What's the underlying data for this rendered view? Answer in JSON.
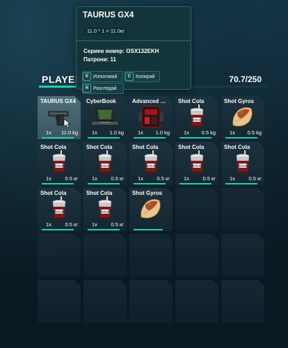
{
  "tooltip": {
    "title": "TAURUS GX4",
    "formula": "11.0 * 1 = 11.0кг",
    "serial_label": "Сериен номер: OSX132EKH",
    "ammo_label": "Патрони: 11",
    "actions": [
      {
        "key": "E",
        "label": "Използвай"
      },
      {
        "key": "C",
        "label": "Копирай"
      },
      {
        "key": "R",
        "label": "Разгледай"
      }
    ]
  },
  "header": {
    "player_label": "PLAYER-",
    "weight": "70.7/250",
    "weight_fraction": 0.2828
  },
  "slots": [
    {
      "name": "TAURUS GX4",
      "qty": "1x",
      "weight": "11.0 kg",
      "icon": "pistol-icon"
    },
    {
      "name": "CyberBook",
      "qty": "1x",
      "weight": "1.0 kg",
      "icon": "laptop-icon"
    },
    {
      "name": "Advanced Phant...",
      "qty": "1x",
      "weight": "1.0 kg",
      "icon": "device-icon"
    },
    {
      "name": "Shot Cola",
      "qty": "1x",
      "weight": "0.5 kg",
      "icon": "cola-cup-icon"
    },
    {
      "name": "Shot Gyros",
      "qty": "1x",
      "weight": "0.5 kg",
      "icon": "gyros-wrap-icon"
    },
    {
      "name": "Shot Cola",
      "qty": "1x",
      "weight": "0.5 кг",
      "icon": "cola-cup-icon"
    },
    {
      "name": "Shot Cola",
      "qty": "1x",
      "weight": "0.5 кг",
      "icon": "cola-cup-icon"
    },
    {
      "name": "Shot Cola",
      "qty": "1x",
      "weight": "0.5 кг",
      "icon": "cola-cup-icon"
    },
    {
      "name": "Shot Cola",
      "qty": "1x",
      "weight": "0.5 кг",
      "icon": "cola-cup-icon"
    },
    {
      "name": "Shot Cola",
      "qty": "1x",
      "weight": "0.5 кг",
      "icon": "cola-cup-icon"
    },
    {
      "name": "Shot Cola",
      "qty": "1x",
      "weight": "0.5 кг",
      "icon": "cola-cup-icon"
    },
    {
      "name": "Shot Cola",
      "qty": "1x",
      "weight": "0.5 кг",
      "icon": "cola-cup-icon"
    },
    {
      "name": "Shot Gyros",
      "qty": "",
      "weight": "",
      "icon": "gyros-wrap-icon"
    }
  ],
  "colors": {
    "accent": "#1ed1b1",
    "tooltip_bg": "#14343a",
    "slot_bg": "#1e3440"
  }
}
